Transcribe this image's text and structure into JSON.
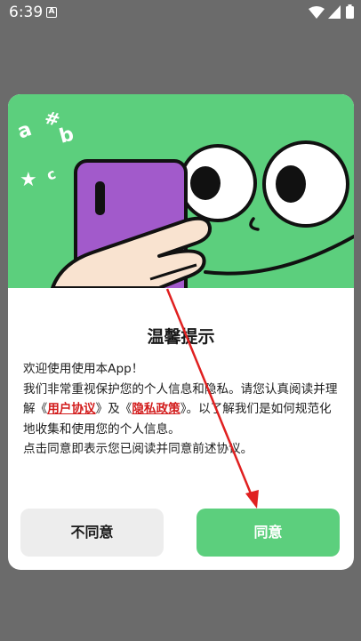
{
  "status_bar": {
    "time": "6:39",
    "notification_letter": "A"
  },
  "dialog": {
    "title": "温馨提示",
    "body": {
      "line1": "欢迎使用使用本App！",
      "line2_a": "我们非常重视保护您的个人信息和隐私。请您认真阅读并理解《",
      "user_agreement": "用户协议",
      "line2_b": "》及《",
      "privacy_policy": "隐私政策",
      "line2_c": "》。以了解我们是如何规范化地收集和使用您的个人信息。",
      "line3": "点击同意即表示您已阅读并同意前述协议。"
    },
    "buttons": {
      "disagree": "不同意",
      "agree": "同意"
    },
    "illustration": {
      "chars": [
        "a",
        "#",
        "b",
        "c",
        "★"
      ]
    }
  },
  "colors": {
    "accent": "#5ccf7d",
    "link": "#d21b1b",
    "phone": "#a25acb",
    "overlay": "#6b6b6b",
    "annotation_arrow": "#e02020"
  }
}
